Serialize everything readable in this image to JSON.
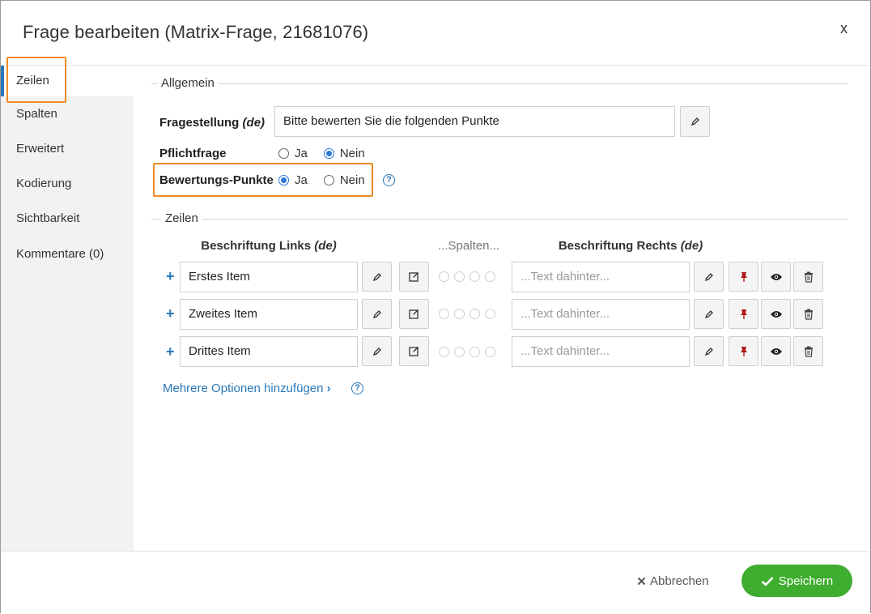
{
  "dialog": {
    "title": "Frage bearbeiten (Matrix-Frage, 21681076)",
    "close_label": "x"
  },
  "sidebar": {
    "items": [
      {
        "label": "Zeilen",
        "active": true
      },
      {
        "label": "Spalten"
      },
      {
        "label": "Erweitert"
      },
      {
        "label": "Kodierung"
      },
      {
        "label": "Sichtbarkeit"
      },
      {
        "label": "Kommentare (0)"
      }
    ]
  },
  "allgemein": {
    "legend": "Allgemein",
    "fragestellung_label": "Fragestellung",
    "lang_tag": "(de)",
    "fragestellung_value": "Bitte bewerten Sie die folgenden Punkte",
    "pflichtfrage_label": "Pflichtfrage",
    "pflichtfrage_options": [
      "Ja",
      "Nein"
    ],
    "pflichtfrage_selected": "Nein",
    "bewertung_label": "Bewertungs-Punkte",
    "bewertung_options": [
      "Ja",
      "Nein"
    ],
    "bewertung_selected": "Ja"
  },
  "zeilen": {
    "legend": "Zeilen",
    "col_left": "Beschriftung Links",
    "col_mid": "...Spalten...",
    "col_right": "Beschriftung Rechts",
    "lang_tag": "(de)",
    "right_placeholder": "...Text dahinter...",
    "rows": [
      {
        "label": "Erstes Item"
      },
      {
        "label": "Zweites Item"
      },
      {
        "label": "Drittes Item"
      }
    ],
    "add_multiple": "Mehrere Optionen hinzufügen"
  },
  "footer": {
    "cancel_label": "Abbrechen",
    "save_label": "Speichern"
  },
  "colors": {
    "accent": "#2b78b8",
    "highlight": "#f08a24",
    "save": "#3fad2f",
    "pin": "#b01c1c"
  },
  "icons": [
    "pencil-icon",
    "edit-square-icon",
    "pin-icon",
    "eye-icon",
    "trash-icon",
    "help-icon",
    "plus-icon",
    "close-icon",
    "check-icon"
  ]
}
